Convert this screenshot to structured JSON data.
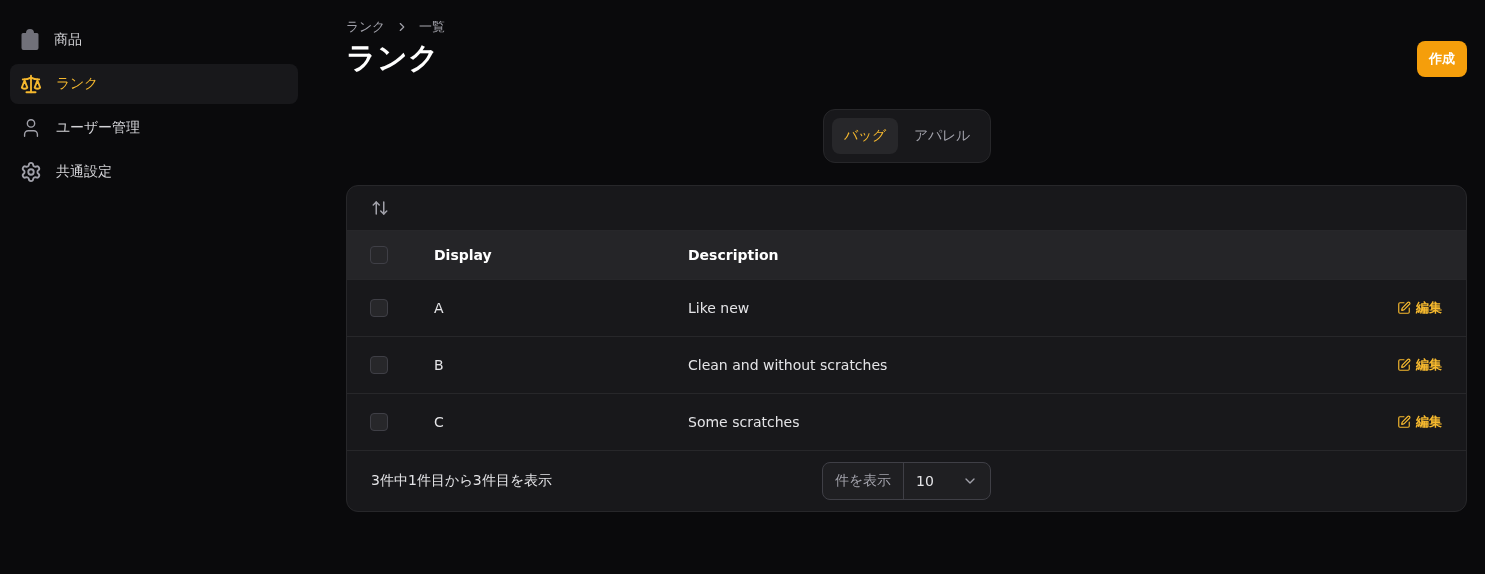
{
  "sidebar": {
    "items": [
      {
        "label": "商品",
        "selected": false
      },
      {
        "label": "ランク",
        "selected": true
      },
      {
        "label": "ユーザー管理",
        "selected": false
      },
      {
        "label": "共通設定",
        "selected": false
      }
    ]
  },
  "breadcrumb": [
    "ランク",
    "一覧"
  ],
  "title": "ランク",
  "create_button": "作成",
  "tabs": [
    {
      "label": "バッグ",
      "selected": true
    },
    {
      "label": "アパレル",
      "selected": false
    }
  ],
  "table": {
    "columns": [
      "Display",
      "Description"
    ],
    "header_checked": false,
    "rows": [
      {
        "display": "A",
        "description": "Like new",
        "checked": false,
        "action": "編集"
      },
      {
        "display": "B",
        "description": "Clean and without scratches",
        "checked": false,
        "action": "編集"
      },
      {
        "display": "C",
        "description": "Some scratches",
        "checked": false,
        "action": "編集"
      }
    ]
  },
  "footer": {
    "summary": "3件中1件目から3件目を表示",
    "per_page_label": "件を表示",
    "per_page_value": "10"
  }
}
